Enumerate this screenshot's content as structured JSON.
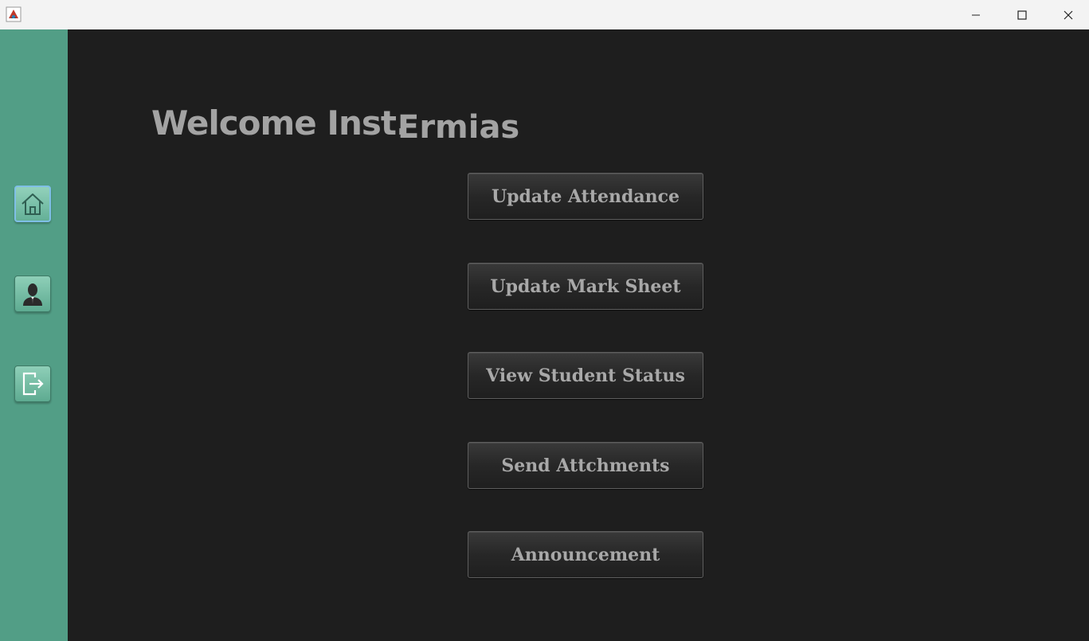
{
  "window": {
    "icons": {
      "app": "java-app-icon",
      "minimize": "minimize-icon",
      "maximize": "maximize-icon",
      "close": "close-icon"
    }
  },
  "sidebar": {
    "items": [
      {
        "icon": "home-icon",
        "active": true
      },
      {
        "icon": "user-icon",
        "active": false
      },
      {
        "icon": "logout-icon",
        "active": false
      }
    ],
    "color": "#529e86"
  },
  "main": {
    "welcome": "Welcome Inst.",
    "instructor_name": "Ermias",
    "actions": [
      {
        "label": "Update Attendance"
      },
      {
        "label": "Update Mark Sheet"
      },
      {
        "label": "View Student Status"
      },
      {
        "label": "Send Attchments"
      },
      {
        "label": "Announcement"
      }
    ],
    "background": "#1e1e1e"
  }
}
